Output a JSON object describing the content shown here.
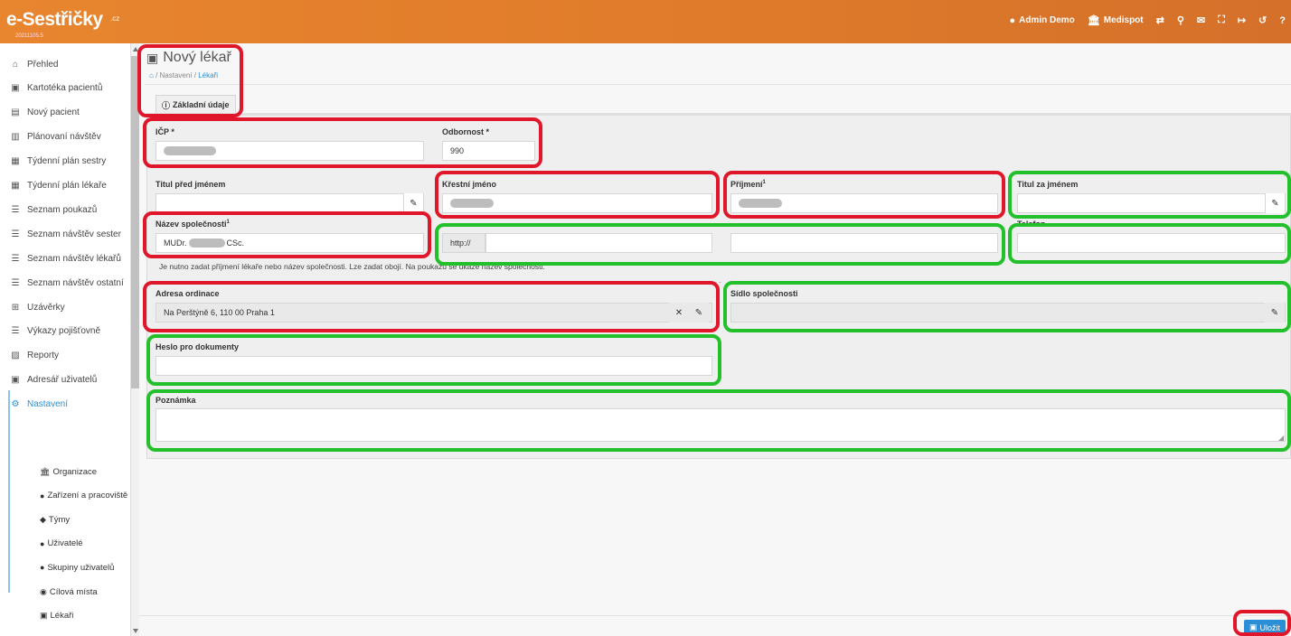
{
  "app": {
    "logo": "e-Sestřičky",
    "logo_suffix": ".cz",
    "version": "20211105.5"
  },
  "topnav": {
    "user": "Admin Demo",
    "organization": "Medispot"
  },
  "sidebar": {
    "items": [
      {
        "icon": "home-icon",
        "glyph": "⌂",
        "label": "Přehled"
      },
      {
        "icon": "id-card-icon",
        "glyph": "▣",
        "label": "Kartotéka pacientů"
      },
      {
        "icon": "id-badge-icon",
        "glyph": "▤",
        "label": "Nový pacient"
      },
      {
        "icon": "map-icon",
        "glyph": "▥",
        "label": "Plánovaní návštěv"
      },
      {
        "icon": "calendar-icon",
        "glyph": "▦",
        "label": "Týdenní plán sestry"
      },
      {
        "icon": "calendar-icon",
        "glyph": "▦",
        "label": "Týdenní plán lékaře"
      },
      {
        "icon": "list-icon",
        "glyph": "☰",
        "label": "Seznam poukazů"
      },
      {
        "icon": "list-icon",
        "glyph": "☰",
        "label": "Seznam návštěv sester"
      },
      {
        "icon": "list-icon",
        "glyph": "☰",
        "label": "Seznam návštěv lékařů"
      },
      {
        "icon": "list-icon",
        "glyph": "☰",
        "label": "Seznam návštěv ostatní"
      },
      {
        "icon": "table-icon",
        "glyph": "⊞",
        "label": "Uzávěrky"
      },
      {
        "icon": "list-icon",
        "glyph": "☰",
        "label": "Výkazy pojišťovně"
      },
      {
        "icon": "chart-icon",
        "glyph": "▨",
        "label": "Reporty"
      },
      {
        "icon": "address-book-icon",
        "glyph": "▣",
        "label": "Adresář uživatelů"
      },
      {
        "icon": "cogs-icon",
        "glyph": "⚙",
        "label": "Nastavení"
      }
    ],
    "subitems": [
      {
        "icon": "bank-icon",
        "glyph": "🏛",
        "label": "Organizace"
      },
      {
        "icon": "medical-icon",
        "glyph": "●",
        "label": "Zařízení a pracoviště"
      },
      {
        "icon": "shield-icon",
        "glyph": "◆",
        "label": "Týmy"
      },
      {
        "icon": "user-icon",
        "glyph": "●",
        "label": "Uživatelé"
      },
      {
        "icon": "users-icon",
        "glyph": "●",
        "label": "Skupiny uživatelů"
      },
      {
        "icon": "map-marker-icon",
        "glyph": "◉",
        "label": "Cílová místa"
      },
      {
        "icon": "doctor-icon",
        "glyph": "▣",
        "label": "Lékaři"
      }
    ]
  },
  "page": {
    "title": "Nový lékař",
    "breadcrumb": {
      "settings": "Nastavení",
      "doctors": "Lékaři"
    },
    "tab": "Základní údaje"
  },
  "form": {
    "icp_label": "IČP *",
    "odbornost_label": "Odbornost *",
    "odbornost_value": "990",
    "titul_pred_label": "Titul před jménem",
    "krestni_label": "Křestní jméno",
    "prijmeni_label": "Příjmení",
    "prijmeni_sup": "1",
    "titul_za_label": "Titul za jménem",
    "nazev_label": "Název společnosti",
    "nazev_sup": "1",
    "nazev_prefix": "MUDr.",
    "nazev_suffix": "CSc.",
    "web_prefix": "http://",
    "telefon_label": "Telefon",
    "note": "Je nutno zadat příjmení lékaře nebo název společnosti. Lze zadat obojí. Na poukazu se ukáže název společnosti.",
    "adresa_label": "Adresa ordinace",
    "adresa_value": "Na Perštýně 6, 110 00 Praha 1",
    "sidlo_label": "Sídlo společnosti",
    "heslo_label": "Heslo pro dokumenty",
    "poznamka_label": "Poznámka"
  },
  "footer": {
    "save_label": "Uložit"
  }
}
